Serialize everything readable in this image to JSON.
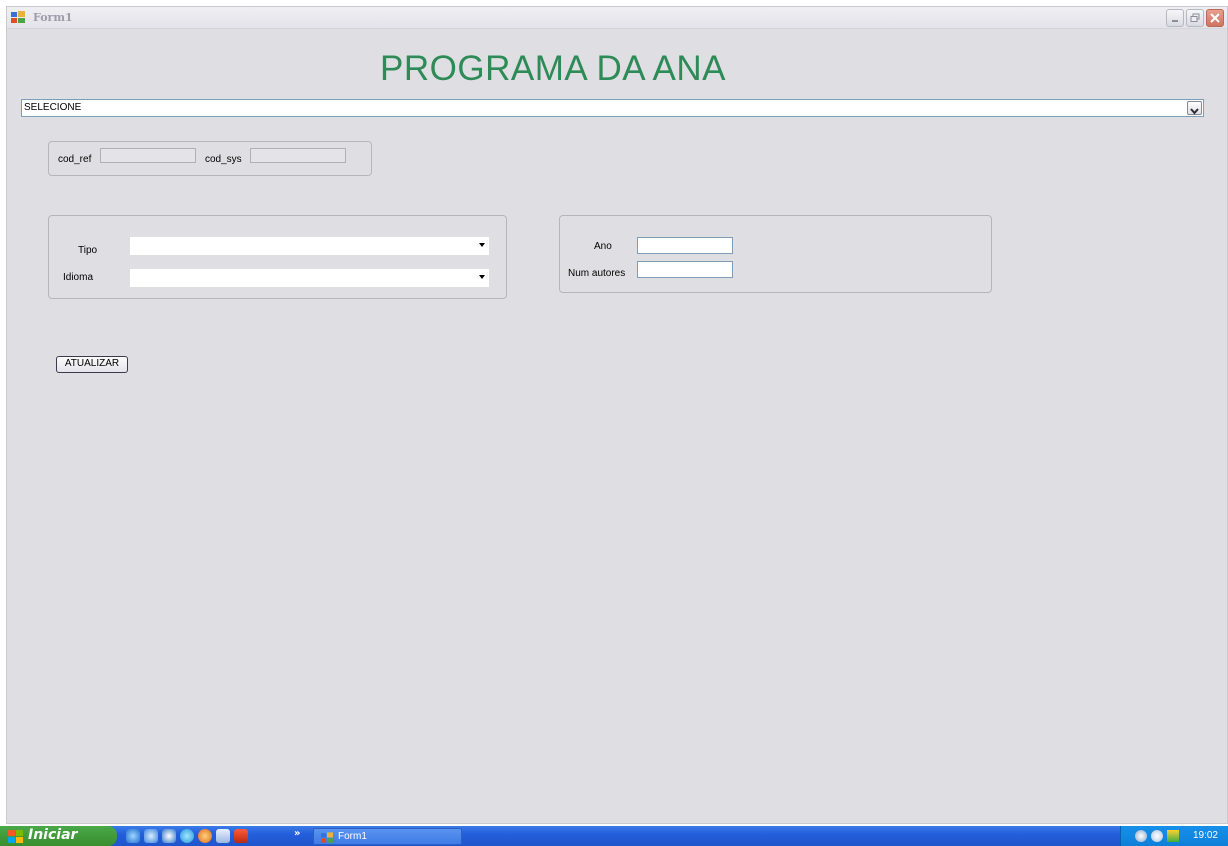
{
  "window": {
    "title": "Form1",
    "heading": "PROGRAMA DA ANA"
  },
  "main_combo": {
    "value": "SELECIONE"
  },
  "codes_group": {
    "cod_ref_label": "cod_ref",
    "cod_sys_label": "cod_sys"
  },
  "details_group": {
    "tipo_label": "Tipo",
    "idioma_label": "Idioma"
  },
  "year_group": {
    "ano_label": "Ano",
    "num_autores_label": "Num autores"
  },
  "update_button": {
    "label": "ATUALIZAR"
  },
  "taskbar": {
    "start_label": "Iniciar",
    "task_label": "Form1",
    "clock": "19:02",
    "more_indicator": "»"
  },
  "colors": {
    "heading": "#2e8b57",
    "form_background": "#dfdfe3",
    "taskbar_blue": "#245edb",
    "start_green": "#3a8e2e"
  }
}
